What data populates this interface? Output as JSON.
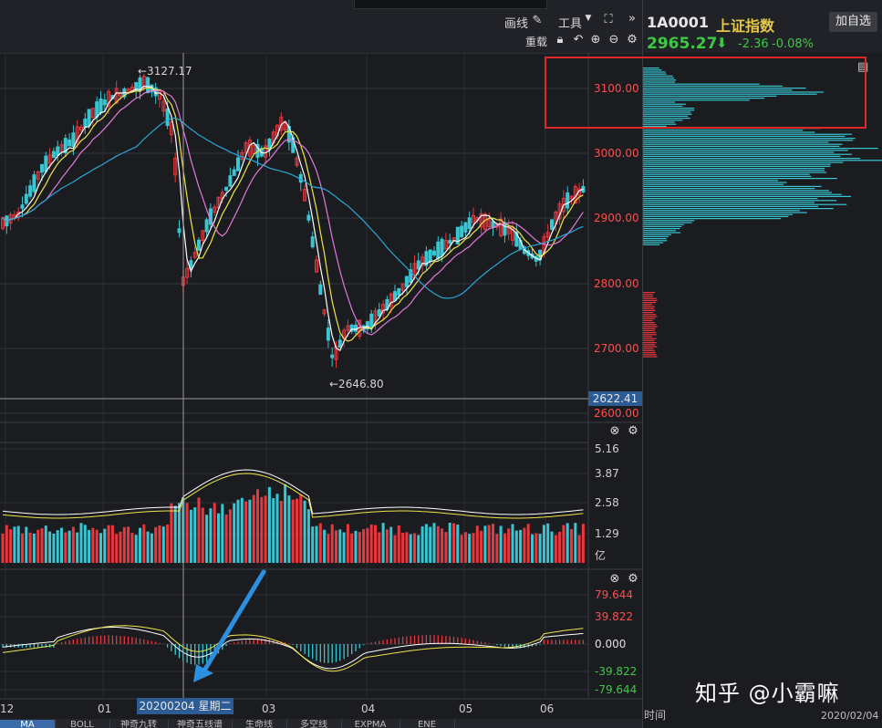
{
  "toolbar": {
    "draw_label": "画线",
    "tools_label": "工具",
    "rights_label": "重载"
  },
  "quote": {
    "code": "1A0001",
    "name": "上证指数",
    "add_button": "加自选",
    "price": "2965.27",
    "change": "-2.36",
    "change_pct": "-0.08%",
    "arrow": "⬇"
  },
  "main_chart": {
    "price_axis": [
      "3100.00",
      "3000.00",
      "2900.00",
      "2800.00",
      "2700.00",
      "2600.00"
    ],
    "high_label": "←3127.17",
    "low_label": "←2646.80",
    "cursor_price": "2622.41"
  },
  "volume_chart": {
    "axis": [
      "5.16",
      "3.87",
      "2.58",
      "1.29"
    ],
    "unit": "亿"
  },
  "macd_chart": {
    "axis": [
      "79.644",
      "39.822",
      "0.000",
      "-39.822",
      "-79.644"
    ]
  },
  "time_axis": {
    "labels": [
      "12",
      "01",
      "03",
      "04",
      "05",
      "06"
    ],
    "cursor_date": "20200204 星期二"
  },
  "bottom_tabs": [
    "MA",
    "BOLL",
    "神奇九转",
    "神奇五线谱",
    "生命线",
    "多空线",
    "EXPMA",
    "ENE"
  ],
  "right_footer": {
    "left": "时间",
    "right": "2020/02/04"
  },
  "watermark": "知乎 @小霸嘛",
  "colors": {
    "up": "#e8383d",
    "down": "#38c6d3",
    "flat_green": "#3ec845",
    "ma5": "#ffffff",
    "ma10": "#f0e54a",
    "ma20": "#e07ad8",
    "ma60": "#2aa6d8",
    "highlight_box": "#e02828"
  }
}
